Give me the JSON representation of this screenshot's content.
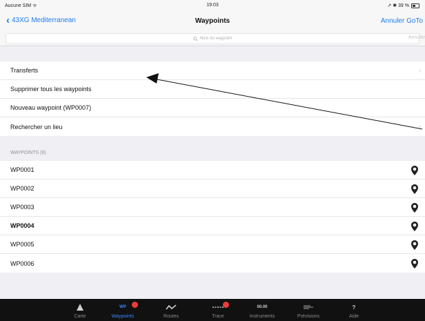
{
  "status_bar": {
    "carrier": "Aucune SIM ᯤ",
    "time": "19:03",
    "battery_text": "↗ ✱ 39 %"
  },
  "nav": {
    "back_label": "43XG Mediterranean",
    "title": "Waypoints",
    "right_label": "Annuler GoTo"
  },
  "search": {
    "placeholder": "Nom du waypoint",
    "cancel_label": "Annuler"
  },
  "actions": [
    {
      "label": "Transferts"
    },
    {
      "label": "Supprimer tous les waypoints"
    },
    {
      "label": "Nouveau waypoint (WP0007)"
    },
    {
      "label": "Rechercher un lieu"
    }
  ],
  "waypoints_section": {
    "header": "WAYPOINTS (6)",
    "items": [
      {
        "name": "WP0001"
      },
      {
        "name": "WP0002"
      },
      {
        "name": "WP0003"
      },
      {
        "name": "WP0004"
      },
      {
        "name": "WP0005"
      },
      {
        "name": "WP0006"
      }
    ]
  },
  "tabs": [
    {
      "label": "Carte",
      "icon": "triangle-icon"
    },
    {
      "label": "Waypoints",
      "icon": "waypoint-icon",
      "icon_text": "WP",
      "active": true
    },
    {
      "label": "Routes",
      "icon": "route-icon"
    },
    {
      "label": "Trace",
      "icon": "trace-icon"
    },
    {
      "label": "Instruments",
      "icon": "instruments-icon",
      "icon_text": "00.00"
    },
    {
      "label": "Prévisions",
      "icon": "forecast-icon"
    },
    {
      "label": "Aide",
      "icon": "help-icon",
      "icon_text": "?"
    }
  ],
  "colors": {
    "accent": "#1a7cf3",
    "tab_active": "#3a86ff",
    "badge": "#ef3b3b"
  }
}
